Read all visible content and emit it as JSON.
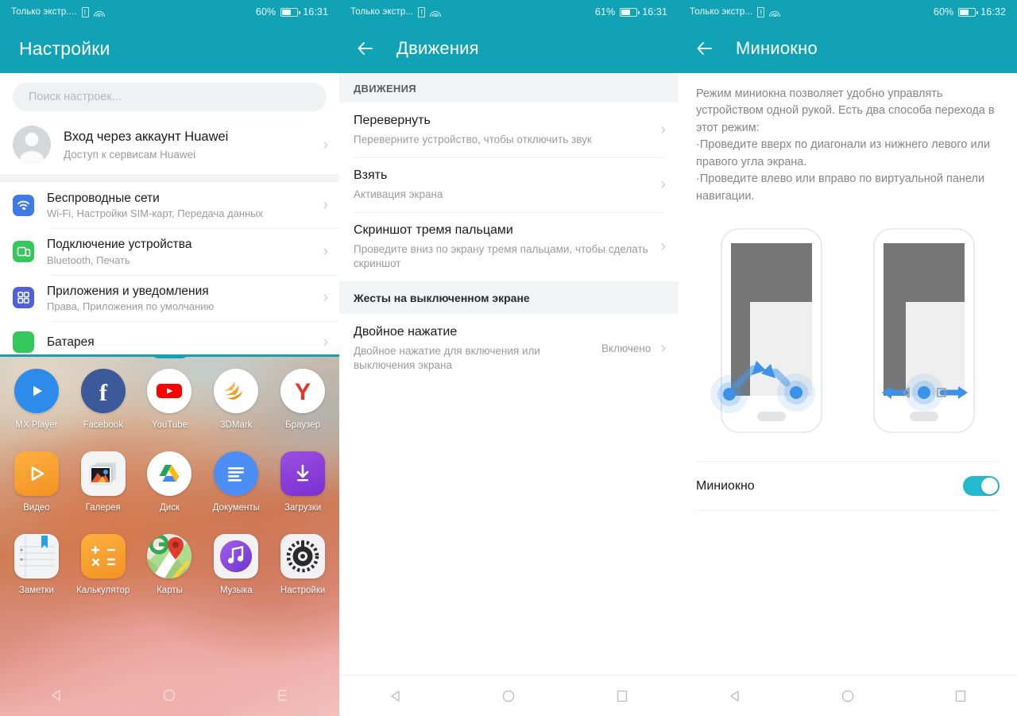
{
  "panels": [
    {
      "status": {
        "carrier": "Только экстр....",
        "battery_pct": "60%",
        "time": "16:31",
        "icons": [
          "sim-alert-icon",
          "wifi-icon",
          "battery-icon"
        ]
      },
      "appbar": {
        "title": "Настройки",
        "has_back": false
      },
      "search": {
        "placeholder": "Поиск настроек..."
      },
      "account": {
        "title": "Вход через аккаунт Huawei",
        "subtitle": "Доступ к сервисам Huawei",
        "chevron": "›"
      },
      "settings_items": [
        {
          "title": "Беспроводные сети",
          "subtitle": "Wi-Fi, Настройки SIM-карт, Передача данных",
          "icon": "wifi-settings-icon",
          "color": "#3E7BE8",
          "chevron": "›"
        },
        {
          "title": "Подключение устройства",
          "subtitle": "Bluetooth, Печать",
          "icon": "device-connect-icon",
          "color": "#34C759",
          "chevron": "›"
        },
        {
          "title": "Приложения и уведомления",
          "subtitle": "Права, Приложения по умолчанию",
          "icon": "apps-grid-icon",
          "color": "#4F63D2",
          "chevron": "›"
        },
        {
          "title": "Батарея",
          "subtitle": "",
          "icon": "battery-settings-icon",
          "color": "#34C759",
          "chevron": "›"
        }
      ],
      "home": {
        "handle": "drag-handle-dots",
        "apps": [
          [
            {
              "label": "MX Player",
              "icon": "mx-player-icon"
            },
            {
              "label": "Facebook",
              "icon": "facebook-icon"
            },
            {
              "label": "YouTube",
              "icon": "youtube-icon"
            },
            {
              "label": "3DMark",
              "icon": "3dmark-icon"
            },
            {
              "label": "Браузер",
              "icon": "yandex-browser-icon"
            }
          ],
          [
            {
              "label": "Видео",
              "icon": "video-icon"
            },
            {
              "label": "Галерея",
              "icon": "gallery-icon"
            },
            {
              "label": "Диск",
              "icon": "google-drive-icon"
            },
            {
              "label": "Документы",
              "icon": "google-docs-icon"
            },
            {
              "label": "Загрузки",
              "icon": "downloads-icon"
            }
          ],
          [
            {
              "label": "Заметки",
              "icon": "notes-icon"
            },
            {
              "label": "Калькулятор",
              "icon": "calculator-icon"
            },
            {
              "label": "Карты",
              "icon": "google-maps-icon"
            },
            {
              "label": "Музыка",
              "icon": "music-icon"
            },
            {
              "label": "Настройки",
              "icon": "settings-gear-icon"
            }
          ]
        ]
      },
      "navbar": {
        "back": "nav-back-icon",
        "home": "nav-home-icon",
        "recents": "nav-recents-icon"
      }
    },
    {
      "status": {
        "carrier": "Только экстр...",
        "battery_pct": "61%",
        "time": "16:31"
      },
      "appbar": {
        "title": "Движения",
        "has_back": true,
        "back": "back-arrow-icon"
      },
      "sections": [
        {
          "header": "ДВИЖЕНИЯ",
          "header_style": "caps",
          "rows": [
            {
              "title": "Перевернуть",
              "subtitle": "Переверните устройство, чтобы отключить звук",
              "value": "",
              "chevron": "›"
            },
            {
              "title": "Взять",
              "subtitle": "Активация экрана",
              "value": "",
              "chevron": "›"
            },
            {
              "title": "Скриншот тремя пальцами",
              "subtitle": "Проведите вниз по экрану тремя пальцами, чтобы сделать скриншот",
              "value": "",
              "chevron": "›"
            }
          ]
        },
        {
          "header": "Жесты на выключенном экране",
          "header_style": "normal",
          "rows": [
            {
              "title": "Двойное нажатие",
              "subtitle": "Двойное нажатие для включения или выключения экрана",
              "value": "Включено",
              "chevron": "›"
            }
          ]
        }
      ],
      "navbar": {
        "back": "nav-back-icon",
        "home": "nav-home-icon",
        "recents": "nav-recents-icon"
      }
    },
    {
      "status": {
        "carrier": "Только экстр...",
        "battery_pct": "60%",
        "time": "16:32"
      },
      "appbar": {
        "title": "Миниокно",
        "has_back": true,
        "back": "back-arrow-icon"
      },
      "description": "Режим миниокна позволяет удобно управлять устройством одной рукой. Есть два способа перехода в этот режим:\n·Проведите вверх по диагонали из нижнего левого или правого угла экрана.\n·Проведите влево или вправо по виртуальной панели навигации.",
      "illustrations": [
        "diagonal-swipe-illustration",
        "navbar-swipe-illustration"
      ],
      "toggle": {
        "label": "Миниокно",
        "state": "on"
      },
      "navbar": {
        "back": "nav-back-icon",
        "home": "nav-home-icon",
        "recents": "nav-recents-icon"
      }
    }
  ],
  "colors": {
    "accent_teal": "#12A2B6",
    "switch_on": "#23BACD",
    "illus_gray": "#767676",
    "illus_blue": "#4A9BEA"
  }
}
